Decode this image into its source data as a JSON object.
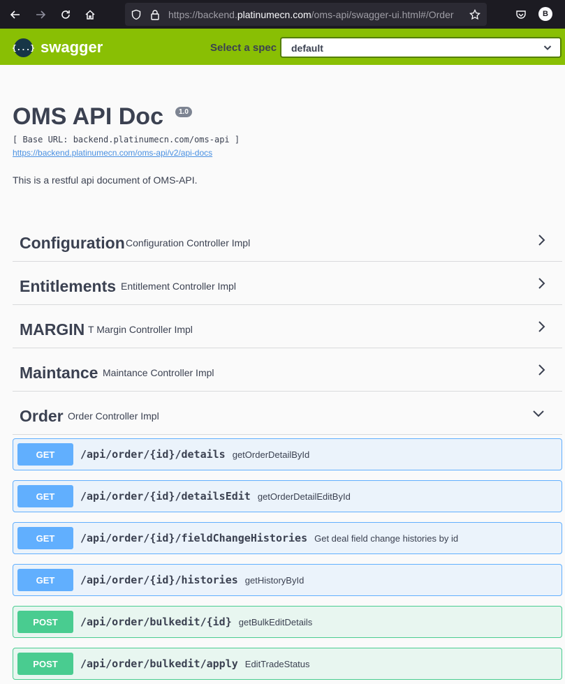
{
  "browser": {
    "url_prefix": "https://backend.",
    "url_host": "platinumecn.com",
    "url_suffix": "/oms-api/swagger-ui.html#/Order",
    "profile_initial": "B"
  },
  "topbar": {
    "logo_text": "swagger",
    "logo_glyph": "{...}",
    "spec_label": "Select a spec",
    "spec_value": "default"
  },
  "info": {
    "title": "OMS API Doc",
    "version": "1.0",
    "base_url": "[ Base URL: backend.platinumecn.com/oms-api ]",
    "docs_link": "https://backend.platinumecn.com/oms-api/v2/api-docs",
    "description": "This is a restful api document of OMS-API."
  },
  "tags": [
    {
      "name": "Configuration",
      "desc": "Configuration Controller Impl",
      "expanded": false
    },
    {
      "name": "Entitlements",
      "desc": "Entitlement Controller Impl",
      "expanded": false
    },
    {
      "name": "MARGIN",
      "desc": "T Margin Controller Impl",
      "expanded": false
    },
    {
      "name": "Maintance",
      "desc": "Maintance Controller Impl",
      "expanded": false
    },
    {
      "name": "Order",
      "desc": "Order Controller Impl",
      "expanded": true
    }
  ],
  "operations": [
    {
      "method": "GET",
      "path": "/api/order/{id}/details",
      "summary": "getOrderDetailById"
    },
    {
      "method": "GET",
      "path": "/api/order/{id}/detailsEdit",
      "summary": "getOrderDetailEditById"
    },
    {
      "method": "GET",
      "path": "/api/order/{id}/fieldChangeHistories",
      "summary": "Get deal field change histories by id"
    },
    {
      "method": "GET",
      "path": "/api/order/{id}/histories",
      "summary": "getHistoryById"
    },
    {
      "method": "POST",
      "path": "/api/order/bulkedit/{id}",
      "summary": "getBulkEditDetails"
    },
    {
      "method": "POST",
      "path": "/api/order/bulkedit/apply",
      "summary": "EditTradeStatus"
    }
  ]
}
